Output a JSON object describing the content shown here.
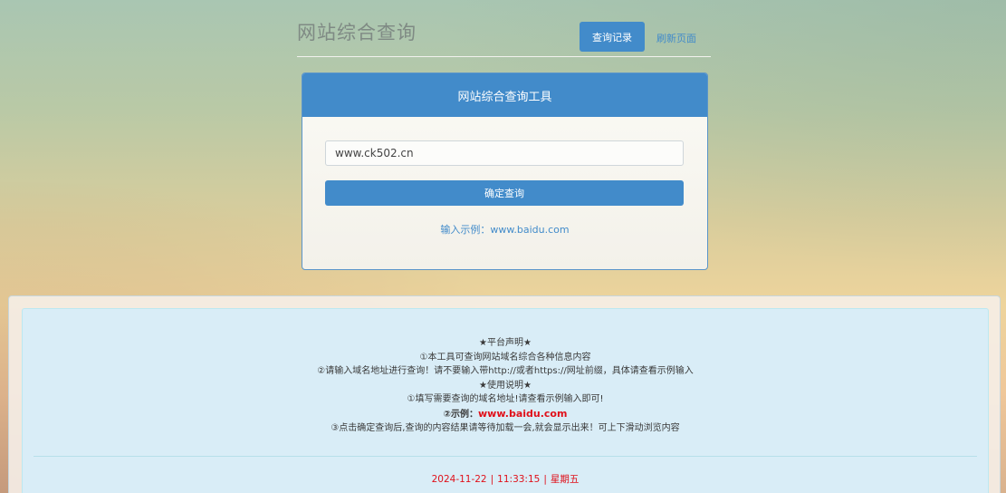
{
  "header": {
    "title": "网站综合查询",
    "history_button": "查询记录",
    "refresh_link": "刷新页面"
  },
  "query_panel": {
    "title": "网站综合查询工具",
    "domain_input_value": "www.ck502.cn",
    "confirm_button": "确定查询",
    "example_hint": "输入示例：www.baidu.com"
  },
  "notice": {
    "platform_heading": "★平台声明★",
    "platform_line_1": "①本工具可查询网站域名综合各种信息内容",
    "platform_line_2": "②请输入域名地址进行查询！请不要输入带http://或者https://网址前缀，具体请查看示例输入",
    "usage_heading": "★使用说明★",
    "usage_line_1": "①填写需要查询的域名地址!请查看示例输入即可!",
    "usage_example_label": "②示例：",
    "usage_example_url": "www.baidu.com",
    "usage_line_3": "③点击确定查询后,查询的内容结果请等待加载一会,就会显示出来！可上下滑动浏览内容"
  },
  "footer": {
    "date": "2024-11-22",
    "time": "11:33:15",
    "weekday": "星期五",
    "separator": "|"
  },
  "colors": {
    "primary": "#428bca",
    "alert_red": "#e0101a",
    "info_bg": "#d9edf7"
  }
}
